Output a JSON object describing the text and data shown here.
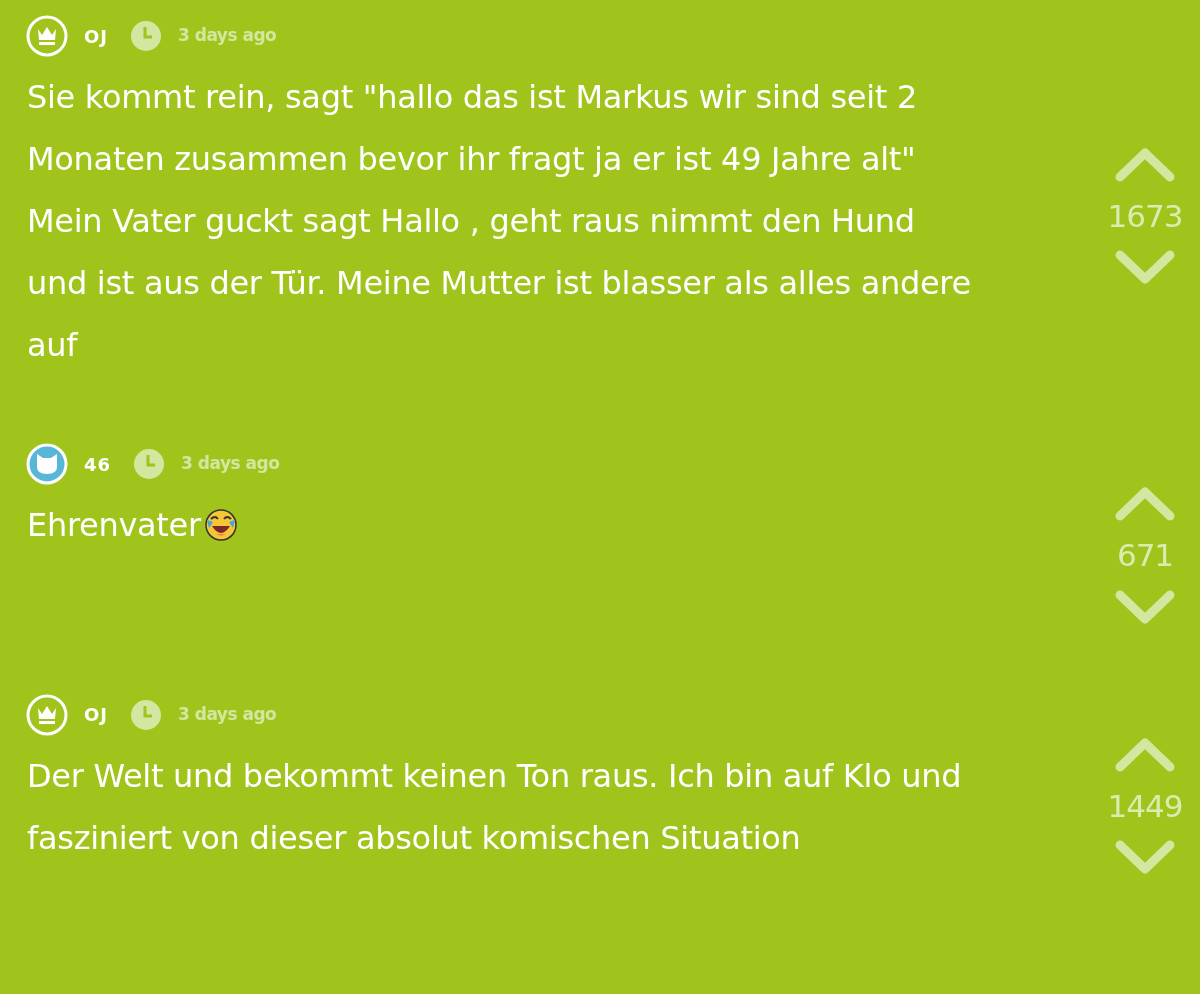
{
  "comments": [
    {
      "kind": "crown",
      "author": "OJ",
      "time": "3 days ago",
      "text": "Sie kommt rein, sagt \"hallo das ist Markus wir sind seit 2 Monaten zusammen bevor ihr fragt ja er ist 49 Jahre alt\" Mein Vater guckt sagt Hallo , geht raus nimmt den Hund und ist aus der Tür. Meine Mutter ist blasser als alles andere auf",
      "emoji": false,
      "votes": "1673"
    },
    {
      "kind": "cat",
      "author": "46",
      "time": "3 days ago",
      "text": "Ehrenvater",
      "emoji": true,
      "votes": "671"
    },
    {
      "kind": "crown",
      "author": "OJ",
      "time": "3 days ago",
      "text": "Der Welt und bekommt keinen Ton raus. Ich bin auf Klo und fasziniert von dieser absolut komischen Situation",
      "emoji": false,
      "votes": "1449"
    }
  ]
}
